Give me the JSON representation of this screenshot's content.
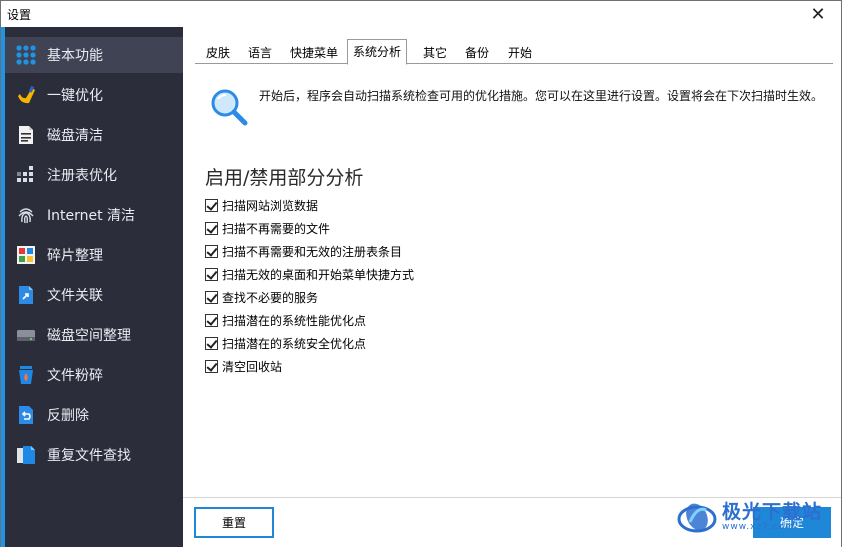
{
  "window": {
    "title": "设置",
    "close_glyph": "✕"
  },
  "sidebar": {
    "items": [
      {
        "label": "基本功能",
        "icon": "grid-icon",
        "active": true
      },
      {
        "label": "一键优化",
        "icon": "wand-icon"
      },
      {
        "label": "磁盘清洁",
        "icon": "disk-file-icon"
      },
      {
        "label": "注册表优化",
        "icon": "registry-icon"
      },
      {
        "label": "Internet 清洁",
        "icon": "fingerprint-icon"
      },
      {
        "label": "碎片整理",
        "icon": "defrag-icon"
      },
      {
        "label": "文件关联",
        "icon": "file-link-icon"
      },
      {
        "label": "磁盘空间整理",
        "icon": "drive-icon"
      },
      {
        "label": "文件粉碎",
        "icon": "shredder-icon"
      },
      {
        "label": "反删除",
        "icon": "undelete-icon"
      },
      {
        "label": "重复文件查找",
        "icon": "duplicate-files-icon"
      }
    ]
  },
  "tabs": [
    {
      "label": "皮肤"
    },
    {
      "label": "语言"
    },
    {
      "label": "快捷菜单"
    },
    {
      "label": "系统分析",
      "active": true
    },
    {
      "label": "其它"
    },
    {
      "label": "备份"
    },
    {
      "label": "开始"
    }
  ],
  "main": {
    "info_text": "开始后，程序会自动扫描系统检查可用的优化措施。您可以在这里进行设置。设置将会在下次扫描时生效。",
    "section_title": "启用/禁用部分分析",
    "options": [
      {
        "label": "扫描网站浏览数据",
        "checked": true
      },
      {
        "label": "扫描不再需要的文件",
        "checked": true
      },
      {
        "label": "扫描不再需要和无效的注册表条目",
        "checked": true
      },
      {
        "label": "扫描无效的桌面和开始菜单快捷方式",
        "checked": true
      },
      {
        "label": "查找不必要的服务",
        "checked": true
      },
      {
        "label": "扫描潜在的系统性能优化点",
        "checked": true
      },
      {
        "label": "扫描潜在的系统安全优化点",
        "checked": true
      },
      {
        "label": "清空回收站",
        "checked": true
      }
    ]
  },
  "footer": {
    "reset_label": "重置",
    "ok_label": "确定"
  },
  "watermark": {
    "text": "极光下载站",
    "sub": "www.xz7.com"
  },
  "colors": {
    "accent": "#1e87d8",
    "sidebar_bg": "#2b2e3a",
    "sidebar_active": "#3f4354"
  }
}
